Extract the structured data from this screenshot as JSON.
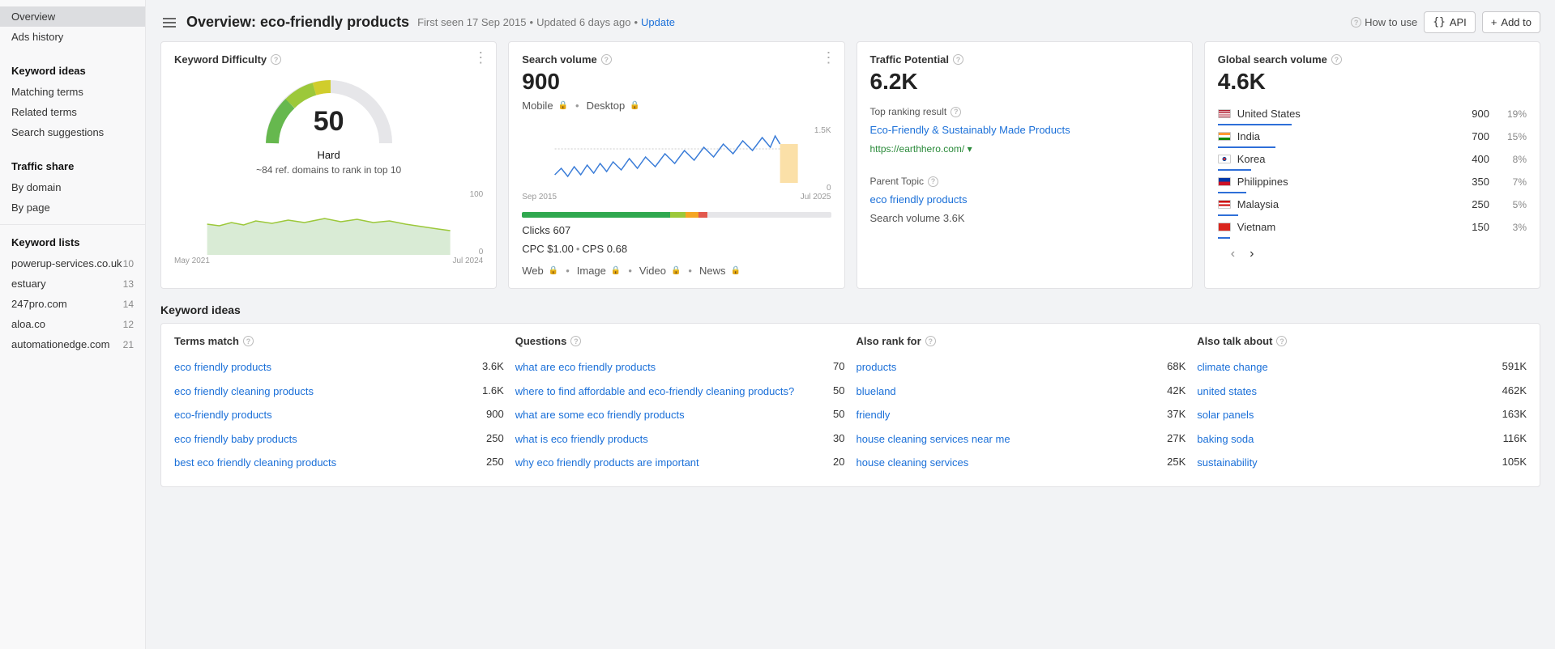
{
  "sidebar": {
    "overview": "Overview",
    "ads_history": "Ads history",
    "keyword_ideas_title": "Keyword ideas",
    "matching_terms": "Matching terms",
    "related_terms": "Related terms",
    "search_suggestions": "Search suggestions",
    "traffic_share_title": "Traffic share",
    "by_domain": "By domain",
    "by_page": "By page",
    "keyword_lists_title": "Keyword lists",
    "lists": [
      {
        "name": "powerup-services.co.uk",
        "count": "10"
      },
      {
        "name": "estuary",
        "count": "13"
      },
      {
        "name": "247pro.com",
        "count": "14"
      },
      {
        "name": "aloa.co",
        "count": "12"
      },
      {
        "name": "automationedge.com",
        "count": "21"
      }
    ]
  },
  "header": {
    "title": "Overview: eco-friendly products",
    "first_seen": "First seen 17 Sep 2015",
    "updated": "Updated 6 days ago",
    "update": "Update",
    "how_to_use": "How to use",
    "api": "API",
    "add_to": "Add to"
  },
  "kd": {
    "title": "Keyword Difficulty",
    "value": "50",
    "label": "Hard",
    "sub": "~84 ref. domains to rank in top 10",
    "axis_top": "100",
    "axis_bottom": "0",
    "date_left": "May 2021",
    "date_right": "Jul 2024"
  },
  "sv": {
    "title": "Search volume",
    "value": "900",
    "mobile": "Mobile",
    "desktop": "Desktop",
    "axis_top": "1.5K",
    "axis_bottom": "0",
    "date_left": "Sep 2015",
    "date_right": "Jul 2025",
    "clicks_label": "Clicks 607",
    "cpc": "CPC $1.00",
    "cps": "CPS 0.68",
    "web": "Web",
    "image": "Image",
    "video": "Video",
    "news": "News"
  },
  "tp": {
    "title": "Traffic Potential",
    "value": "6.2K",
    "top_ranking_label": "Top ranking result",
    "top_ranking_title": "Eco-Friendly & Sustainably Made Products",
    "top_ranking_url": "https://earthhero.com/",
    "parent_topic_label": "Parent Topic",
    "parent_topic": "eco friendly products",
    "parent_sv": "Search volume 3.6K"
  },
  "gv": {
    "title": "Global search volume",
    "value": "4.6K",
    "countries": [
      {
        "name": "United States",
        "val": "900",
        "pct": "19%",
        "bar": 100,
        "flag": "us"
      },
      {
        "name": "India",
        "val": "700",
        "pct": "15%",
        "bar": 78,
        "flag": "in"
      },
      {
        "name": "Korea",
        "val": "400",
        "pct": "8%",
        "bar": 45,
        "flag": "kr"
      },
      {
        "name": "Philippines",
        "val": "350",
        "pct": "7%",
        "bar": 39,
        "flag": "ph"
      },
      {
        "name": "Malaysia",
        "val": "250",
        "pct": "5%",
        "bar": 28,
        "flag": "my"
      },
      {
        "name": "Vietnam",
        "val": "150",
        "pct": "3%",
        "bar": 17,
        "flag": "vn"
      }
    ]
  },
  "ideas": {
    "section_title": "Keyword ideas",
    "terms_match": {
      "title": "Terms match",
      "rows": [
        {
          "kw": "eco friendly products",
          "val": "3.6K"
        },
        {
          "kw": "eco friendly cleaning products",
          "val": "1.6K"
        },
        {
          "kw": "eco-friendly products",
          "val": "900"
        },
        {
          "kw": "eco friendly baby products",
          "val": "250"
        },
        {
          "kw": "best eco friendly cleaning products",
          "val": "250"
        }
      ]
    },
    "questions": {
      "title": "Questions",
      "rows": [
        {
          "kw": "what are eco friendly products",
          "val": "70"
        },
        {
          "kw": "where to find affordable and eco-friendly cleaning products?",
          "val": "50"
        },
        {
          "kw": "what are some eco friendly products",
          "val": "50"
        },
        {
          "kw": "what is eco friendly products",
          "val": "30"
        },
        {
          "kw": "why eco friendly products are important",
          "val": "20"
        }
      ]
    },
    "also_rank": {
      "title": "Also rank for",
      "rows": [
        {
          "kw": "products",
          "val": "68K"
        },
        {
          "kw": "blueland",
          "val": "42K"
        },
        {
          "kw": "friendly",
          "val": "37K"
        },
        {
          "kw": "house cleaning services near me",
          "val": "27K"
        },
        {
          "kw": "house cleaning services",
          "val": "25K"
        }
      ]
    },
    "also_talk": {
      "title": "Also talk about",
      "rows": [
        {
          "kw": "climate change",
          "val": "591K"
        },
        {
          "kw": "united states",
          "val": "462K"
        },
        {
          "kw": "solar panels",
          "val": "163K"
        },
        {
          "kw": "baking soda",
          "val": "116K"
        },
        {
          "kw": "sustainability",
          "val": "105K"
        }
      ]
    }
  },
  "flags": {
    "us": "linear-gradient(to bottom,#b22234 0 15%,#fff 15% 30%,#b22234 30% 45%,#fff 45% 60%,#b22234 60% 75%,#fff 75% 90%,#b22234 90% 100%)",
    "in": "linear-gradient(to bottom,#ff9933 0 33%,#fff 33% 66%,#138808 66% 100%)",
    "kr": "radial-gradient(circle at 50% 50%,#cd2e3a 0 18%,#0047a0 18% 30%,#fff 30% 100%)",
    "ph": "linear-gradient(to bottom,#0038a8 0 50%,#ce1126 50% 100%)",
    "my": "linear-gradient(to bottom,#cc0001 0 25%,#fff 25% 50%,#cc0001 50% 75%,#fff 75% 100%)",
    "vn": "linear-gradient(#da251d,#da251d)"
  }
}
